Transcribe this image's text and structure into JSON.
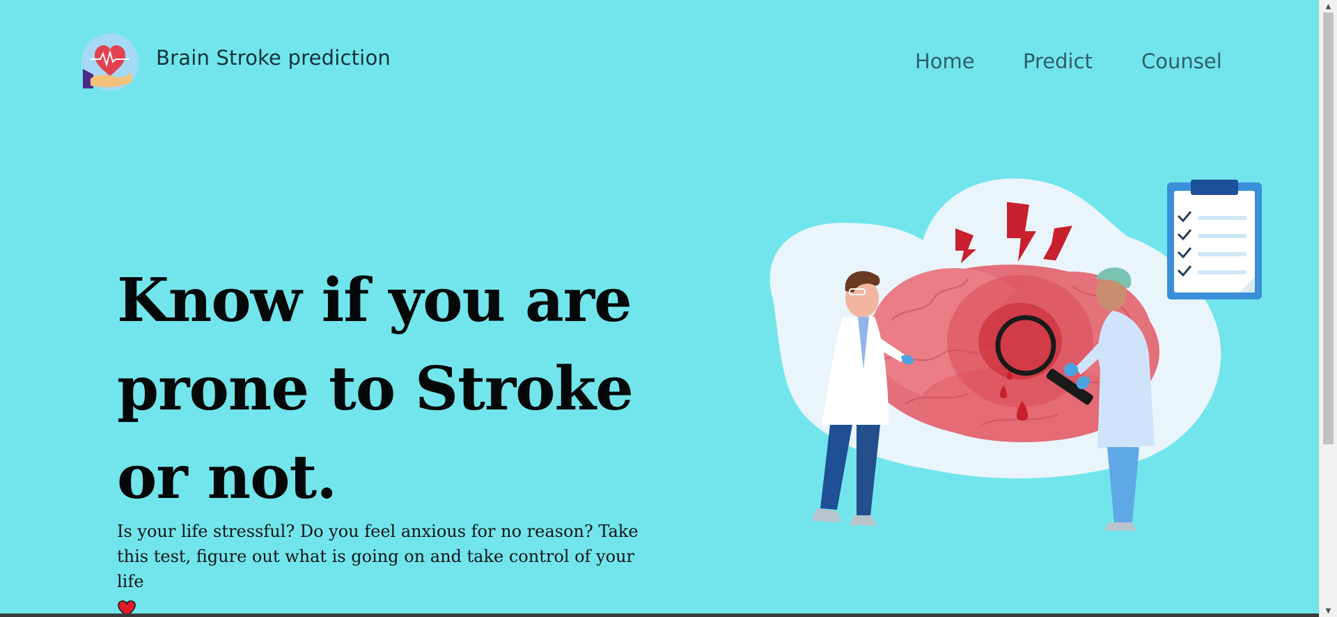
{
  "header": {
    "brand": "Brain Stroke prediction",
    "logo_icon": "heart-hand-logo-icon"
  },
  "nav": {
    "items": [
      {
        "label": "Home"
      },
      {
        "label": "Predict"
      },
      {
        "label": "Counsel"
      }
    ]
  },
  "hero": {
    "title": "Know if you are prone to Stroke or not.",
    "subtitle": "Is your life stressful? Do you feel anxious for no reason? Take this test, figure out what is going on and take control of your life",
    "subtitle_icon": "heart-icon"
  },
  "illustration": {
    "name": "doctors-examining-brain-illustration"
  },
  "colors": {
    "background": "#72e5ec",
    "text": "#050808",
    "nav_text": "#2f5e66",
    "accent_red": "#d62b3c"
  }
}
